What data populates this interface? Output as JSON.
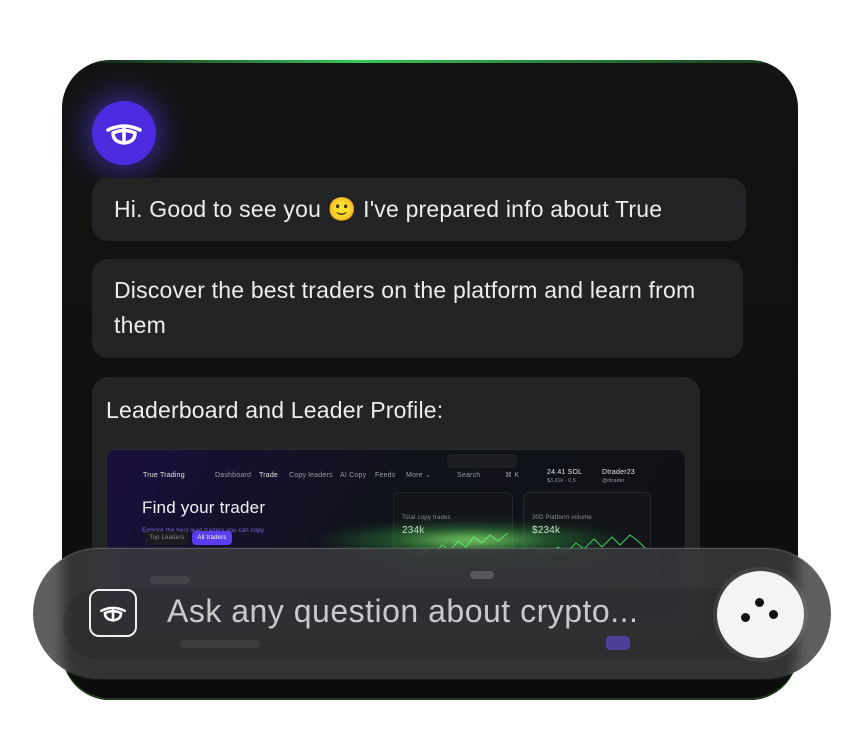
{
  "chat": {
    "messages": [
      "Hi. Good to see you 🙂 I've prepared info about True",
      "Discover the best traders on the platform and learn from them",
      "Leaderboard and Leader Profile:"
    ]
  },
  "preview": {
    "brand": "True Trading",
    "nav": [
      "Dashboard",
      "Trade",
      "Copy leaders",
      "AI Copy",
      "Feeds",
      "More ⌄"
    ],
    "search_placeholder": "Search",
    "search_shortcut": "⌘ K",
    "balance": "24.41 SOL",
    "balance_sub": "$3.21k · 0.5",
    "username": "Dtrader23",
    "user_sub": "@dtrader",
    "heading": "Find your trader",
    "subheading": "Explore the best lead traders you can copy",
    "tab_top": "Top Leaders",
    "tab_all": "All traders",
    "card1_title": "Total copy trades",
    "card1_value": "234k",
    "card2_title": "30D Platform volume",
    "card2_value": "$234k"
  },
  "input": {
    "placeholder": "Ask any question about crypto..."
  },
  "colors": {
    "accent": "#4b2ae0",
    "glow": "#38c759",
    "bubble": "#222324"
  }
}
